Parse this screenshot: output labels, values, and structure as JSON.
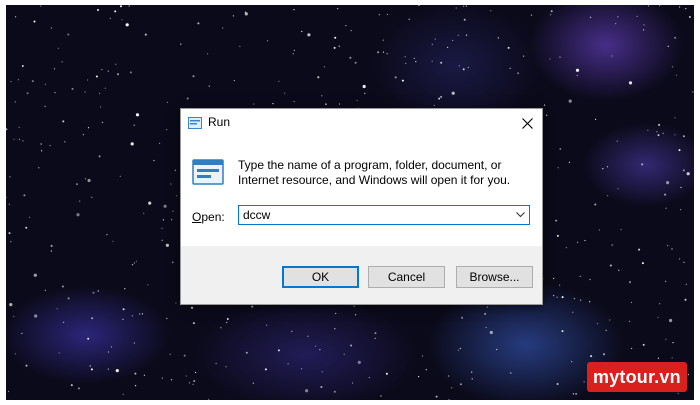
{
  "dialog": {
    "title": "Run",
    "description": "Type the name of a program, folder, document, or Internet resource, and Windows will open it for you.",
    "open_label_accel": "O",
    "open_label_rest": "pen:",
    "input_value": "dccw",
    "buttons": {
      "ok": "OK",
      "cancel": "Cancel",
      "browse": "Browse..."
    }
  },
  "watermark": "mytour.vn",
  "colors": {
    "focus_accent": "#0078d7",
    "button_bar_bg": "#f0f0f0",
    "watermark_bg": "#d9201c"
  }
}
